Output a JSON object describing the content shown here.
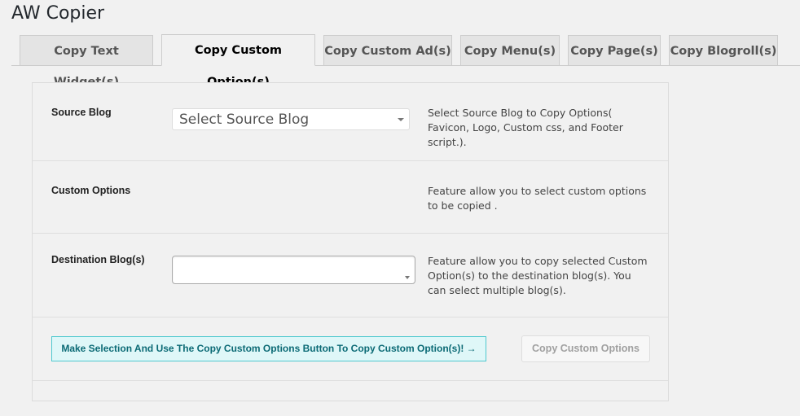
{
  "app": {
    "title": "AW Copier"
  },
  "tabs": [
    {
      "label": "Copy Text Widget(s)",
      "active": false
    },
    {
      "label": "Copy Custom Option(s)",
      "active": true
    },
    {
      "label": "Copy Custom Ad(s)",
      "active": false
    },
    {
      "label": "Copy Menu(s)",
      "active": false
    },
    {
      "label": "Copy Page(s)",
      "active": false
    },
    {
      "label": "Copy Blogroll(s)",
      "active": false
    }
  ],
  "form": {
    "source_blog": {
      "label": "Source Blog",
      "placeholder": "Select Source Blog",
      "description": "Select Source Blog to Copy Options( Favicon, Logo, Custom css, and Footer script.)."
    },
    "custom_options": {
      "label": "Custom Options",
      "description": "Feature allow you to select custom options to be copied ."
    },
    "destination_blogs": {
      "label": "Destination Blog(s)",
      "value": "",
      "description": "Feature allow you to copy selected Custom Option(s) to the destination blog(s). You can select multiple blog(s)."
    }
  },
  "actions": {
    "info_label": "Make Selection And Use The Copy Custom Options Button To Copy Custom Option(s)! →",
    "copy_label": "Copy Custom Options"
  },
  "colors": {
    "info_bg": "#dff7f8",
    "info_border": "#4fc9cf",
    "info_text": "#0b6a75"
  }
}
